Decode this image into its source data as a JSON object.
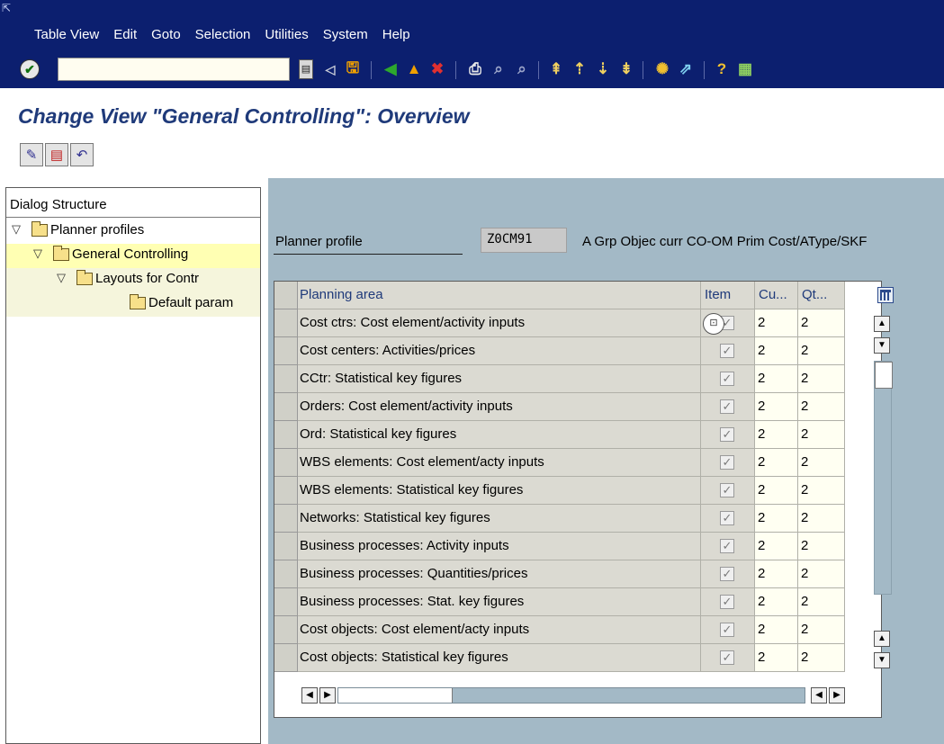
{
  "menu": {
    "items": [
      "Table View",
      "Edit",
      "Goto",
      "Selection",
      "Utilities",
      "System",
      "Help"
    ]
  },
  "title": "Change View \"General Controlling\": Overview",
  "dialog_structure": {
    "header": "Dialog Structure",
    "nodes": [
      {
        "label": "Planner profiles",
        "level": 0,
        "expanded": true
      },
      {
        "label": "General Controlling",
        "level": 1,
        "expanded": true,
        "selected": true
      },
      {
        "label": "Layouts for Contr",
        "level": 2,
        "expanded": true
      },
      {
        "label": "Default param",
        "level": 3,
        "expanded": false
      }
    ]
  },
  "planner_profile": {
    "label": "Planner profile",
    "value": "Z0CM91",
    "description": "A Grp Objec curr CO-OM Prim Cost/AType/SKF"
  },
  "table": {
    "headers": {
      "area": "Planning area",
      "item": "Item",
      "cu": "Cu...",
      "qt": "Qt..."
    },
    "rows": [
      {
        "area": "Cost ctrs: Cost element/activity inputs",
        "item": true,
        "cu": "2",
        "qt": "2"
      },
      {
        "area": "Cost centers: Activities/prices",
        "item": true,
        "cu": "2",
        "qt": "2"
      },
      {
        "area": "CCtr: Statistical key figures",
        "item": true,
        "cu": "2",
        "qt": "2"
      },
      {
        "area": "Orders: Cost element/activity inputs",
        "item": true,
        "cu": "2",
        "qt": "2"
      },
      {
        "area": "Ord: Statistical key figures",
        "item": true,
        "cu": "2",
        "qt": "2"
      },
      {
        "area": "WBS elements: Cost element/acty inputs",
        "item": true,
        "cu": "2",
        "qt": "2"
      },
      {
        "area": "WBS elements: Statistical key figures",
        "item": true,
        "cu": "2",
        "qt": "2"
      },
      {
        "area": "Networks: Statistical key figures",
        "item": true,
        "cu": "2",
        "qt": "2"
      },
      {
        "area": "Business processes: Activity inputs",
        "item": true,
        "cu": "2",
        "qt": "2"
      },
      {
        "area": "Business processes: Quantities/prices",
        "item": true,
        "cu": "2",
        "qt": "2"
      },
      {
        "area": "Business processes: Stat. key figures",
        "item": true,
        "cu": "2",
        "qt": "2"
      },
      {
        "area": "Cost objects: Cost element/acty inputs",
        "item": true,
        "cu": "2",
        "qt": "2"
      },
      {
        "area": "Cost objects: Statistical key figures",
        "item": true,
        "cu": "2",
        "qt": "2"
      }
    ]
  },
  "colors": {
    "menubar": "#0c1f6f",
    "title": "#1f3a7a",
    "panel": "#a3b9c6"
  }
}
